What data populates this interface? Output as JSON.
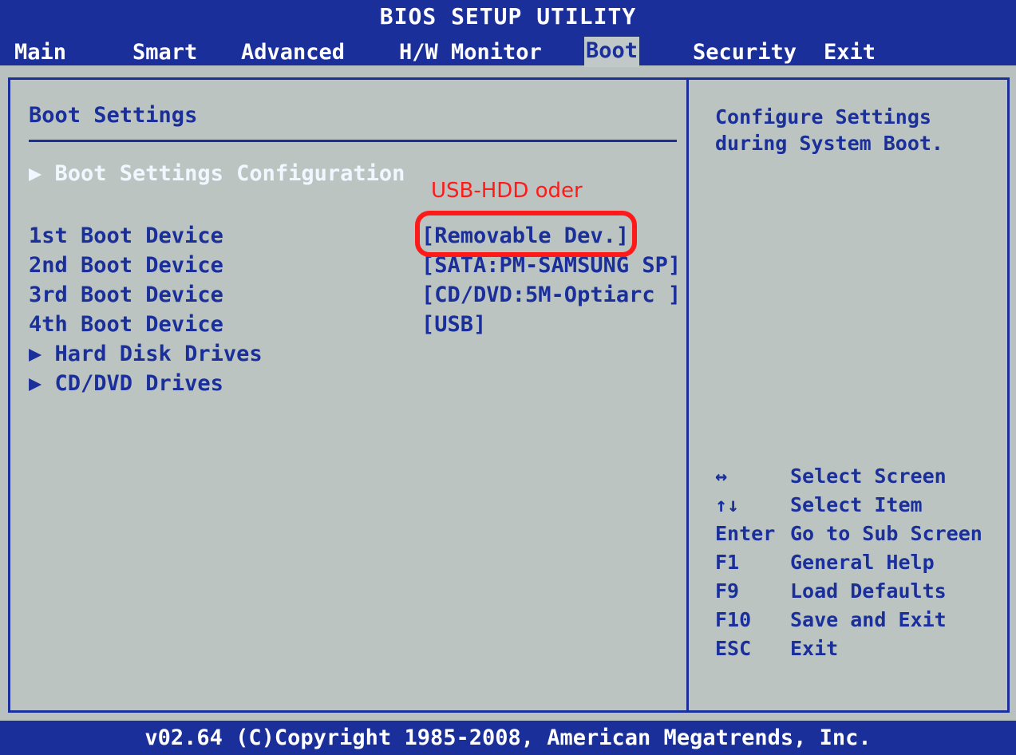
{
  "header": {
    "title": "BIOS SETUP UTILITY",
    "tabs": [
      "Main",
      "Smart",
      "Advanced",
      "H/W Monitor",
      "Boot",
      "Security",
      "Exit"
    ],
    "active_tab": "Boot"
  },
  "left": {
    "section_title": "Boot Settings",
    "submenu": "Boot Settings Configuration",
    "boot_devices": [
      {
        "label": "1st Boot Device",
        "value": "[Removable Dev.]"
      },
      {
        "label": "2nd Boot Device",
        "value": "[SATA:PM-SAMSUNG SP]"
      },
      {
        "label": "3rd Boot Device",
        "value": "[CD/DVD:5M-Optiarc ]"
      },
      {
        "label": "4th Boot Device",
        "value": "[USB]"
      }
    ],
    "submenus": [
      "Hard Disk Drives",
      "CD/DVD Drives"
    ]
  },
  "right": {
    "help_text": "Configure Settings\nduring System Boot.",
    "keys": [
      {
        "key": "↔",
        "desc": "Select Screen"
      },
      {
        "key": "↑↓",
        "desc": "Select Item"
      },
      {
        "key": "Enter",
        "desc": "Go to Sub Screen"
      },
      {
        "key": "F1",
        "desc": "General Help"
      },
      {
        "key": "F9",
        "desc": "Load Defaults"
      },
      {
        "key": "F10",
        "desc": "Save and Exit"
      },
      {
        "key": "ESC",
        "desc": "Exit"
      }
    ]
  },
  "footer": {
    "text": "v02.64 (C)Copyright 1985-2008, American Megatrends, Inc."
  },
  "annotation": {
    "text": "USB-HDD oder"
  },
  "colors": {
    "bios_blue": "#1a2f9a",
    "bios_gray": "#bcc4c2",
    "annotation_red": "#ff1a1a"
  },
  "icons": {
    "submenu_arrow": "triangle-right-icon"
  }
}
